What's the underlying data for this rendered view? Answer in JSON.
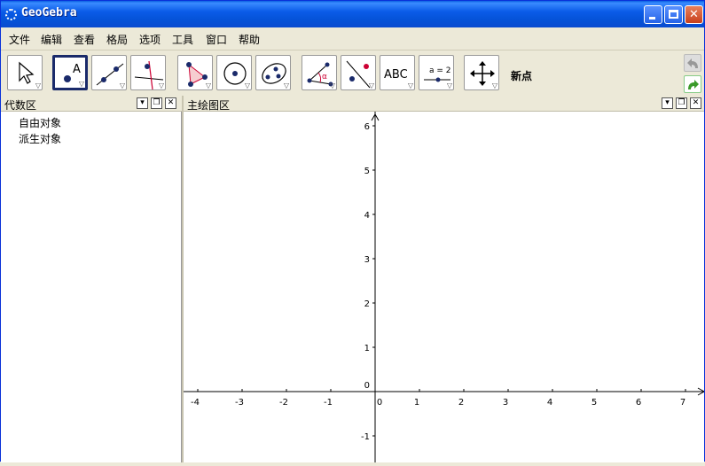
{
  "window": {
    "title": "GeoGebra"
  },
  "menu": {
    "items": [
      "文件",
      "编辑",
      "查看",
      "格局",
      "选项",
      "工具",
      "窗口",
      "帮助"
    ]
  },
  "toolbar": {
    "active_tool_label": "新点"
  },
  "algebra_view": {
    "title": "代数区",
    "items": [
      "自由对象",
      "派生对象"
    ]
  },
  "graphics_view": {
    "title": "主绘图区",
    "x_ticks": [
      "-4",
      "-3",
      "-2",
      "-1",
      "0",
      "1",
      "2",
      "3",
      "4",
      "5",
      "6",
      "7"
    ],
    "y_ticks": [
      "6",
      "5",
      "4",
      "3",
      "2",
      "1",
      "0",
      "-1"
    ]
  },
  "colors": {
    "titlebar": "#0a5fe0",
    "accent": "#1a2a6a",
    "axis": "#000000"
  },
  "icons": [
    "move-tool-icon",
    "new-point-icon",
    "line-through-points-icon",
    "perpendicular-line-icon",
    "polygon-icon",
    "circle-icon",
    "conic-icon",
    "angle-icon",
    "reflect-icon",
    "text-tool-icon",
    "slider-icon",
    "move-view-icon",
    "undo-icon",
    "redo-icon"
  ]
}
